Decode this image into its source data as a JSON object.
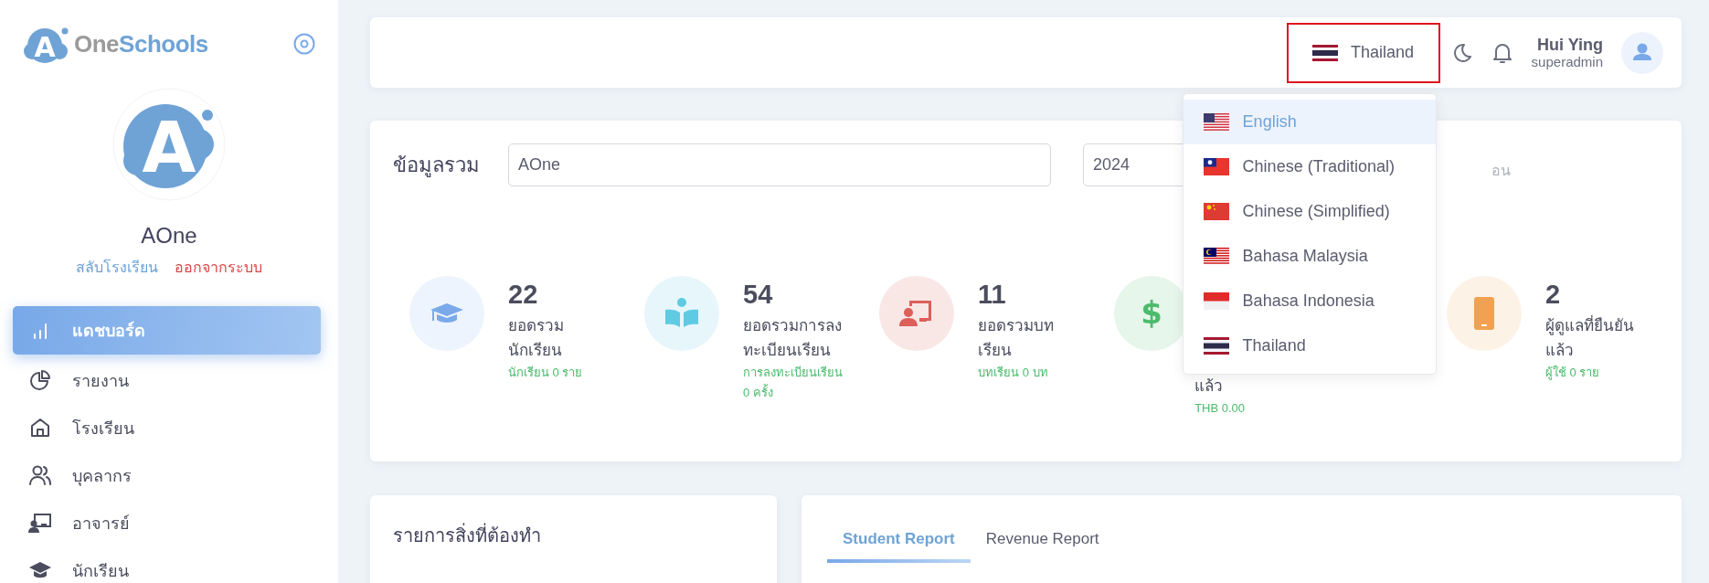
{
  "sidebar": {
    "logo_letter": "A",
    "brand_part_1": "One",
    "brand_part_2": "Schools",
    "school_logo_letter": "A",
    "school_name": "AOne",
    "switch_link": "สลับโรงเรียน",
    "logout_link": "ออกจากระบบ",
    "nav": [
      {
        "label": "แดชบอร์ด",
        "selected": true
      },
      {
        "label": "รายงาน",
        "selected": false
      },
      {
        "label": "โรงเรียน",
        "selected": false
      },
      {
        "label": "บุคลากร",
        "selected": false
      },
      {
        "label": "อาจารย์",
        "selected": false
      },
      {
        "label": "นักเรียน",
        "selected": false
      }
    ]
  },
  "header": {
    "language": "Thailand",
    "user_name": "Hui Ying",
    "user_role": "superadmin",
    "languages": [
      {
        "label": "English",
        "selected": true
      },
      {
        "label": "Chinese (Traditional)",
        "selected": false
      },
      {
        "label": "Chinese (Simplified)",
        "selected": false
      },
      {
        "label": "Bahasa Malaysia",
        "selected": false
      },
      {
        "label": "Bahasa Indonesia",
        "selected": false
      },
      {
        "label": "Thailand",
        "selected": false
      }
    ]
  },
  "overview": {
    "title": "ข้อมูลรวม",
    "school_value": "AOne",
    "year_value": "2024",
    "month_text": "อน",
    "stats": [
      {
        "kind": "full",
        "number": "22",
        "label": "ยอดรวมนักเรียน",
        "sub": "นักเรียน 0 ราย"
      },
      {
        "kind": "full",
        "number": "54",
        "label": "ยอดรวมการลงทะเบียนเรียน",
        "sub": "การลงทะเบียนเรียน 0 ครั้ง"
      },
      {
        "kind": "full",
        "number": "11",
        "label": "ยอดรวมบทเรียน",
        "sub": "บทเรียน 0 บท"
      },
      {
        "kind": "partial",
        "symbol": "$",
        "label": "แล้ว",
        "sub": "THB 0.00"
      },
      {
        "kind": "full",
        "number": "2",
        "label": "ผู้ดูแลที่ยืนยันแล้ว",
        "sub": "ผู้ใช้ 0 ราย"
      }
    ]
  },
  "todo": {
    "title": "รายการสิ่งที่ต้องทำ"
  },
  "report": {
    "tabs": [
      {
        "label": "Student Report",
        "selected": true
      },
      {
        "label": "Revenue Report",
        "selected": false
      }
    ]
  }
}
